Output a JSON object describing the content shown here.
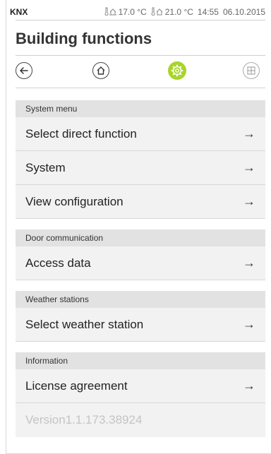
{
  "statusbar": {
    "brand": "KNX",
    "outdoor_temp": "17.0 °C",
    "indoor_temp": "21.0 °C",
    "time": "14:55",
    "date": "06.10.2015"
  },
  "page": {
    "title": "Building functions"
  },
  "toolbar": {
    "back_icon": "arrow-left-circle",
    "home_icon": "house",
    "settings_icon": "gear",
    "grid_icon": "grid",
    "active_color": "#a8d52a"
  },
  "menu": {
    "sections": [
      {
        "header": "System menu",
        "items": [
          {
            "label": "Select direct function"
          },
          {
            "label": "System"
          },
          {
            "label": "View configuration"
          }
        ]
      },
      {
        "header": "Door communication",
        "items": [
          {
            "label": "Access data"
          }
        ]
      },
      {
        "header": "Weather stations",
        "items": [
          {
            "label": "Select weather station"
          }
        ]
      },
      {
        "header": "Information",
        "items": [
          {
            "label": "License agreement"
          }
        ]
      }
    ],
    "version": "Version1.1.173.38924",
    "arrow": "→"
  }
}
